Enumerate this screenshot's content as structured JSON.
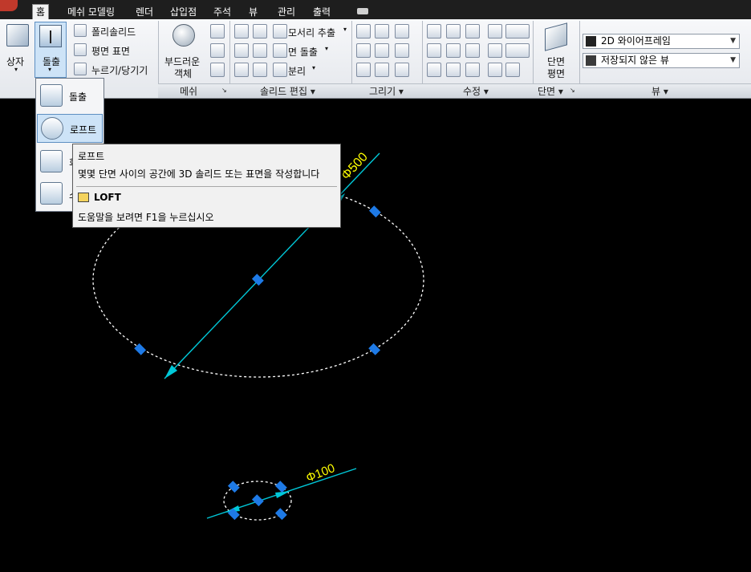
{
  "tabs": [
    "홈",
    "메쉬 모델링",
    "렌더",
    "삽입점",
    "주석",
    "뷰",
    "관리",
    "출력"
  ],
  "ribbon": {
    "box_label": "상자",
    "extrude_label": "돌출",
    "polysolid_label": "폴리솔리드",
    "planar_surface_label": "평면 표면",
    "presspull_label": "누르기/당기기",
    "smooth_object_label1": "부드러운",
    "smooth_object_label2": "객체",
    "extract_edges_label": "모서리 추출",
    "face_extrude_label": "면 돌출",
    "separate_label": "분리",
    "section_plane_label1": "단면",
    "section_plane_label2": "평면",
    "visual_style": "2D 와이어프레임",
    "view_state": "저장되지 않은 뷰"
  },
  "panels": {
    "mesh": "메쉬",
    "solid_edit": "솔리드 편집 ▾",
    "draw": "그리기 ▾",
    "modify": "수정 ▾",
    "section": "단면 ▾",
    "view": "뷰 ▾"
  },
  "dropdown_menu": {
    "items": [
      "돌출",
      "로프트",
      "회전",
      "스윕"
    ]
  },
  "tooltip": {
    "title": "로프트",
    "description": "몇몇 단면 사이의 공간에 3D 솔리드 또는 표면을 작성합니다",
    "command": "LOFT",
    "help": "도움말을 보려면 F1을 누르십시오"
  },
  "dimensions": {
    "large": "Φ500",
    "small": "Φ100"
  },
  "colors": {
    "dimension_line": "#00c8d8",
    "dimension_text": "#ffff00",
    "grip": "#1e7ae6",
    "circle": "#ffffff"
  }
}
